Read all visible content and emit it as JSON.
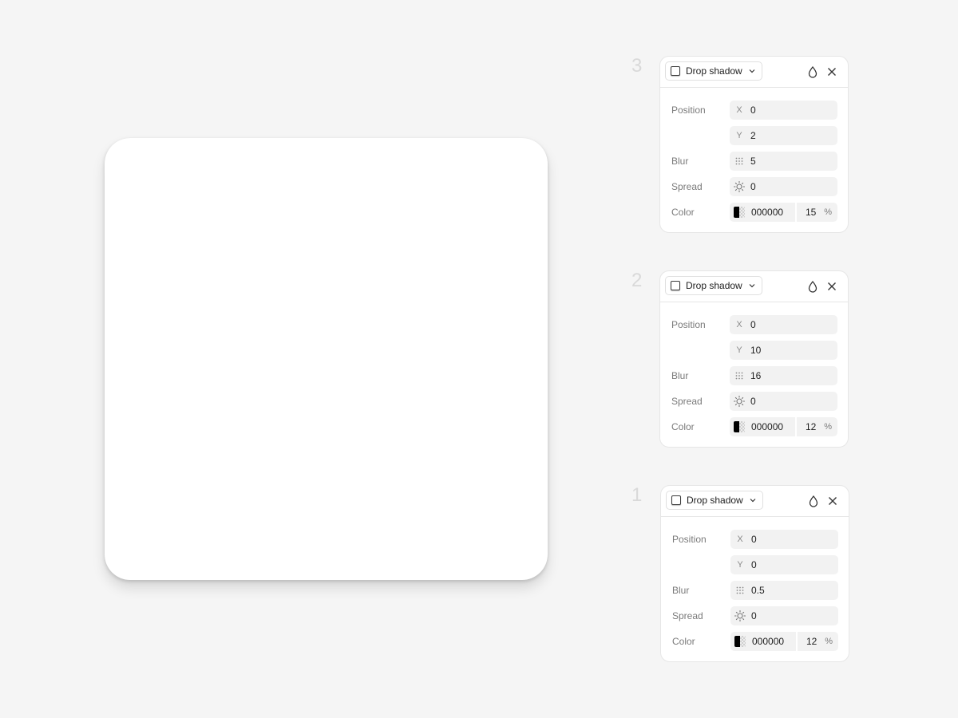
{
  "panels": [
    {
      "step": "3",
      "effect_type": "Drop shadow",
      "labels": {
        "position": "Position",
        "blur": "Blur",
        "spread": "Spread",
        "color": "Color"
      },
      "x_prefix": "X",
      "y_prefix": "Y",
      "x": "0",
      "y": "2",
      "blur": "5",
      "spread": "0",
      "color_hex": "000000",
      "opacity": "15",
      "percent": "%"
    },
    {
      "step": "2",
      "effect_type": "Drop shadow",
      "labels": {
        "position": "Position",
        "blur": "Blur",
        "spread": "Spread",
        "color": "Color"
      },
      "x_prefix": "X",
      "y_prefix": "Y",
      "x": "0",
      "y": "10",
      "blur": "16",
      "spread": "0",
      "color_hex": "000000",
      "opacity": "12",
      "percent": "%"
    },
    {
      "step": "1",
      "effect_type": "Drop shadow",
      "labels": {
        "position": "Position",
        "blur": "Blur",
        "spread": "Spread",
        "color": "Color"
      },
      "x_prefix": "X",
      "y_prefix": "Y",
      "x": "0",
      "y": "0",
      "blur": "0.5",
      "spread": "0",
      "color_hex": "000000",
      "opacity": "12",
      "percent": "%"
    }
  ],
  "icons": {
    "effect_swatch": "drop-shadow-swatch-icon",
    "dropdown": "chevron-down-icon",
    "visibility": "droplet-icon",
    "remove": "close-icon",
    "blur": "blur-dots-icon",
    "spread": "sun-icon"
  },
  "colors": {
    "background": "#f5f5f5",
    "card": "#ffffff",
    "step_number": "#d9d9d9",
    "field_bg": "#f2f2f2"
  }
}
